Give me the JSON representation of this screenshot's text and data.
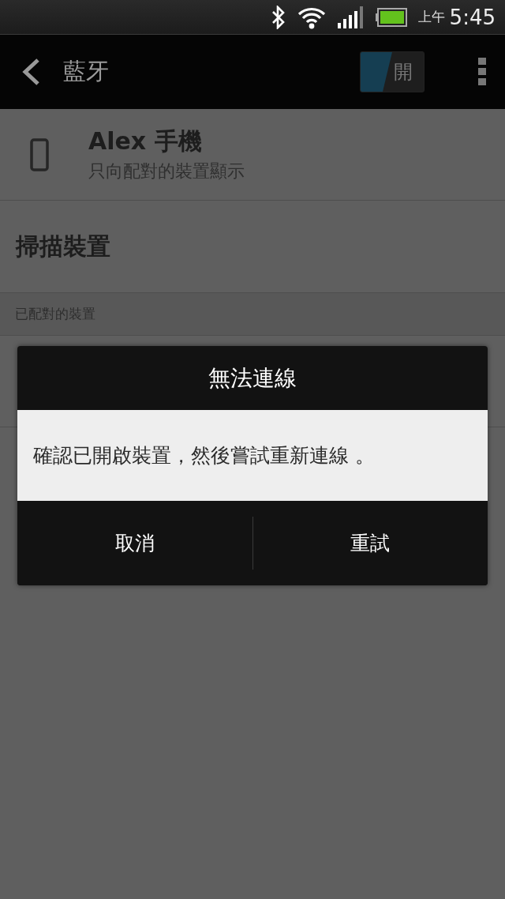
{
  "status_bar": {
    "period": "上午",
    "time": "5:45"
  },
  "action_bar": {
    "title": "藍牙",
    "toggle": {
      "label": "開",
      "on": true
    }
  },
  "device": {
    "name": "Alex 手機",
    "subtitle": "只向配對的裝置顯示"
  },
  "scan": {
    "label": "掃描裝置"
  },
  "section": {
    "header": "已配對的裝置"
  },
  "dialog": {
    "title": "無法連線",
    "message": "確認已開啟裝置，然後嘗試重新連線 。",
    "buttons": [
      "取消",
      "重試"
    ]
  }
}
